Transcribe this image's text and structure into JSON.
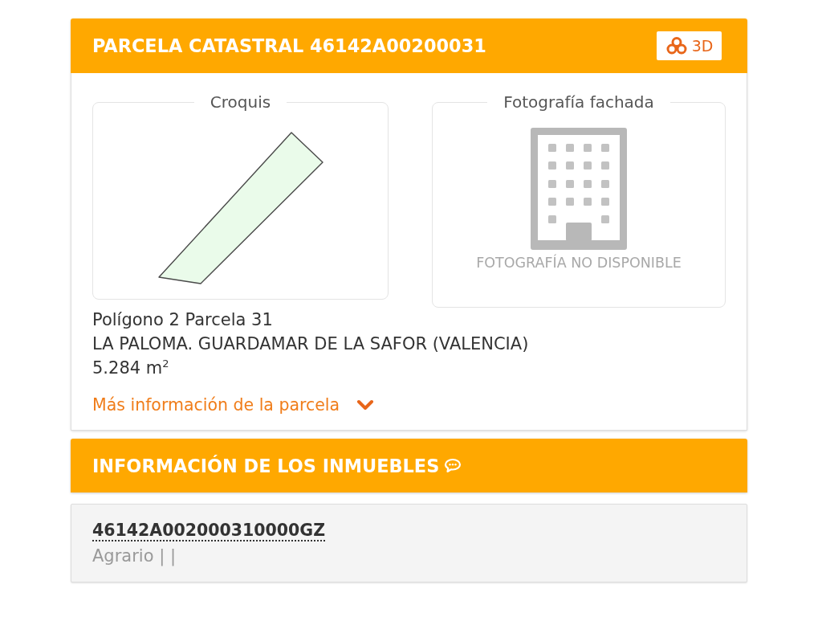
{
  "parcel_panel": {
    "title": "PARCELA CATASTRAL 46142A00200031",
    "view_3d_button": "3D",
    "sketch": {
      "title": "Croquis"
    },
    "facade_photo": {
      "title": "Fotografía fachada",
      "no_photo_text": "FOTOGRAFÍA NO DISPONIBLE"
    },
    "details": [
      "Polígono 2 Parcela 31",
      "LA PALOMA. GUARDAMAR DE LA SAFOR (VALENCIA)",
      "5.284 m$^{2}$"
    ],
    "more_info": {
      "label": "Más información de la parcela",
      "expanded": false
    }
  },
  "properties_panel": {
    "title": "INFORMACIÓN DE LOS INMUEBLES",
    "properties": [
      {
        "reference": "46142A002000310000GZ",
        "use": "Agrario | |"
      }
    ]
  }
}
